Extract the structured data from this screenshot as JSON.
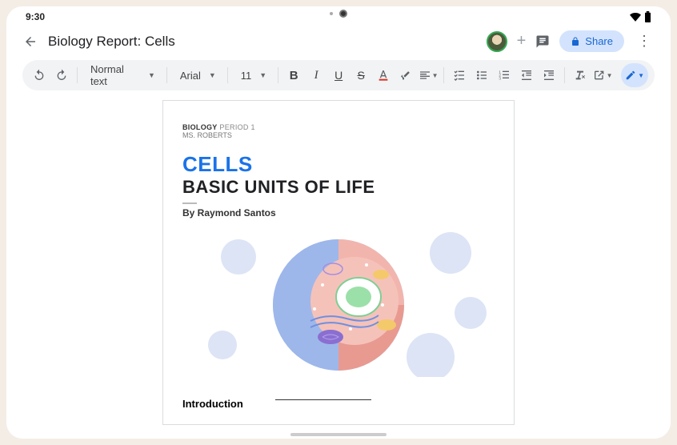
{
  "status": {
    "time": "9:30"
  },
  "header": {
    "title": "Biology Report: Cells",
    "share_label": "Share"
  },
  "toolbar": {
    "style_label": "Normal text",
    "font_label": "Arial",
    "size_label": "11"
  },
  "doc": {
    "kicker_bold": "BIOLOGY",
    "kicker_rest": " PERIOD 1",
    "teacher": "MS. ROBERTS",
    "title": "CELLS",
    "subtitle": "BASIC UNITS OF LIFE",
    "byline": "By Raymond Santos",
    "intro_heading": "Introduction"
  }
}
